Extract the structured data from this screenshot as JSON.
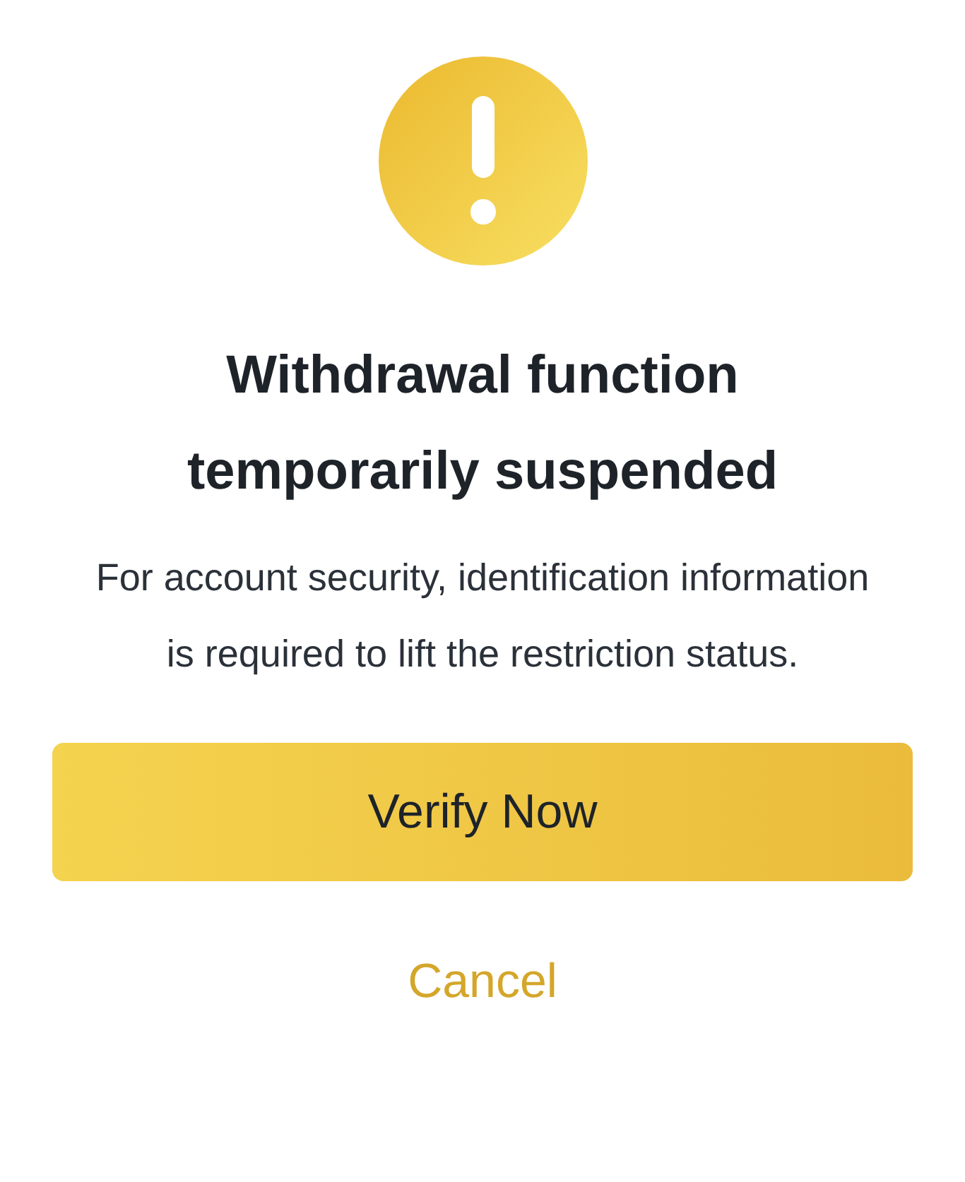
{
  "dialog": {
    "title": "Withdrawal function temporarily suspended",
    "message": "For account security, identification information is required to lift the restriction status.",
    "buttons": [
      {
        "kind": "primary",
        "label": "Verify Now"
      },
      {
        "kind": "link",
        "label": "Cancel"
      }
    ]
  }
}
